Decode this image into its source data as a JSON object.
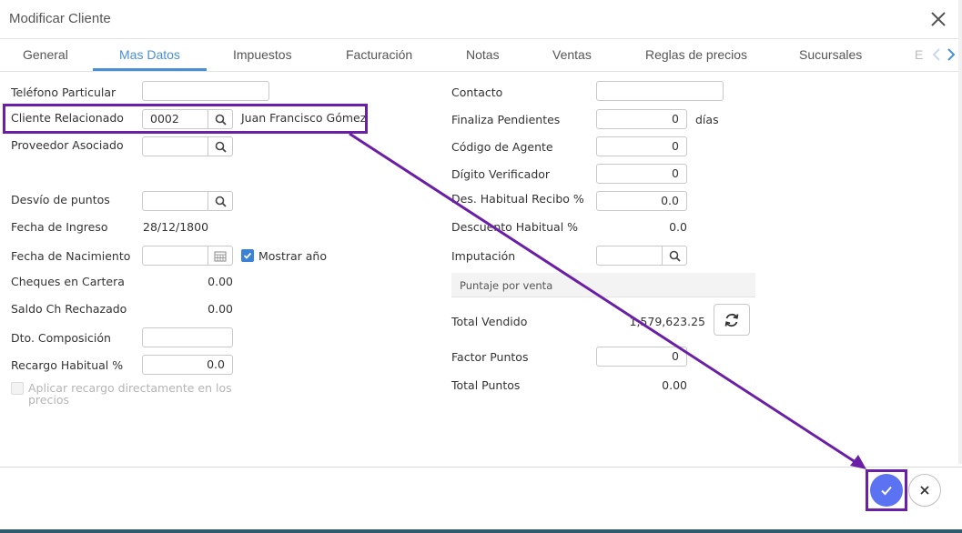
{
  "dialog": {
    "title": "Modificar Cliente"
  },
  "tabs": [
    {
      "label": "General"
    },
    {
      "label": "Mas Datos"
    },
    {
      "label": "Impuestos"
    },
    {
      "label": "Facturación"
    },
    {
      "label": "Notas"
    },
    {
      "label": "Ventas"
    },
    {
      "label": "Reglas de precios"
    },
    {
      "label": "Sucursales"
    },
    {
      "label": "E"
    }
  ],
  "left": {
    "telefono_particular": {
      "label": "Teléfono Particular",
      "value": ""
    },
    "cliente_relacionado": {
      "label": "Cliente Relacionado",
      "value": "0002",
      "name": "Juan Francisco Gómez"
    },
    "proveedor_asociado": {
      "label": "Proveedor Asociado",
      "value": ""
    },
    "desvio_puntos": {
      "label": "Desvío de puntos",
      "value": ""
    },
    "fecha_ingreso": {
      "label": "Fecha de Ingreso",
      "value": "28/12/1800"
    },
    "fecha_nacimiento": {
      "label": "Fecha de Nacimiento",
      "value": "",
      "checkbox_label": "Mostrar año",
      "checked": true
    },
    "cheques_cartera": {
      "label": "Cheques en Cartera",
      "value": "0.00"
    },
    "saldo_rechazado": {
      "label": "Saldo Ch Rechazado",
      "value": "0.00"
    },
    "dto_composicion": {
      "label": "Dto. Composición",
      "value": ""
    },
    "recargo_habitual": {
      "label": "Recargo Habitual %",
      "value": "0.0"
    },
    "aplicar_recargo": {
      "label_line1": "Aplicar recargo directamente en los",
      "label_line2": "precios",
      "checked": false
    }
  },
  "right": {
    "contacto": {
      "label": "Contacto",
      "value": ""
    },
    "finaliza_pendientes": {
      "label": "Finaliza Pendientes",
      "value": "0",
      "unit": "días"
    },
    "codigo_agente": {
      "label": "Código de Agente",
      "value": "0"
    },
    "digito_verificador": {
      "label": "Dígito Verificador",
      "value": "0"
    },
    "des_habitual_recibo": {
      "label": "Des. Habitual Recibo %",
      "value": "0.0"
    },
    "descuento_habitual": {
      "label": "Descuento Habitual %",
      "value": "0.0"
    },
    "imputacion": {
      "label": "Imputación",
      "value": ""
    },
    "puntaje_section": {
      "title": "Puntaje por venta"
    },
    "total_vendido": {
      "label": "Total Vendido",
      "value": "1,579,623.25"
    },
    "factor_puntos": {
      "label": "Factor Puntos",
      "value": "0"
    },
    "total_puntos": {
      "label": "Total Puntos",
      "value": "0.00"
    }
  },
  "icons": {
    "close": "close-icon",
    "search": "search-icon",
    "calendar": "calendar-icon",
    "refresh": "refresh-icon",
    "confirm": "check-icon",
    "cancel": "close-icon"
  },
  "colors": {
    "accent": "#4a8fd6",
    "confirm": "#5b73f2",
    "annotation": "#6b1fa6"
  }
}
